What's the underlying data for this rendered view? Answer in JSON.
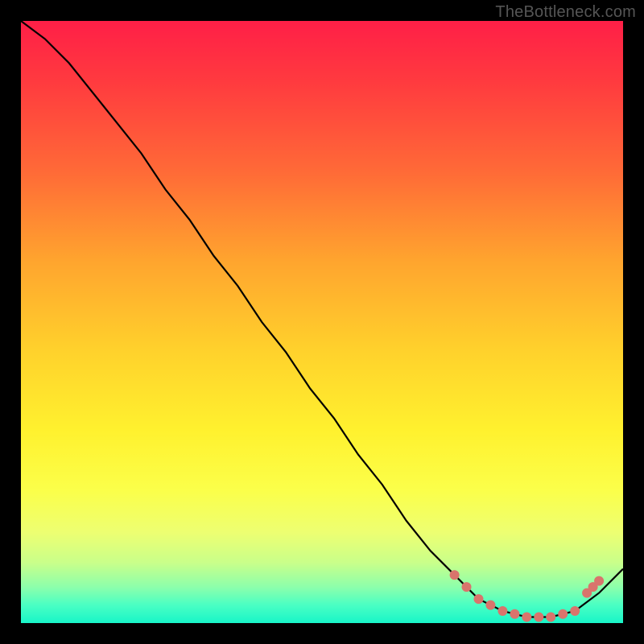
{
  "watermark": "TheBottleneck.com",
  "colors": {
    "background": "#000000",
    "gradient_top": "#ff1f47",
    "gradient_bottom": "#18f5c8",
    "curve": "#000000",
    "marker": "#d9746c"
  },
  "chart_data": {
    "type": "line",
    "title": "",
    "xlabel": "",
    "ylabel": "",
    "xlim": [
      0,
      100
    ],
    "ylim": [
      0,
      100
    ],
    "x": [
      0,
      4,
      8,
      12,
      16,
      20,
      24,
      28,
      32,
      36,
      40,
      44,
      48,
      52,
      56,
      60,
      64,
      68,
      72,
      76,
      80,
      84,
      88,
      92,
      96,
      100
    ],
    "values": [
      100,
      97,
      93,
      88,
      83,
      78,
      72,
      67,
      61,
      56,
      50,
      45,
      39,
      34,
      28,
      23,
      17,
      12,
      8,
      4,
      2,
      1,
      1,
      2,
      5,
      9
    ],
    "markers": {
      "x": [
        72,
        74,
        76,
        78,
        80,
        82,
        84,
        86,
        88,
        90,
        92,
        94,
        95,
        96
      ],
      "y": [
        8,
        6,
        4,
        3,
        2,
        1.5,
        1,
        1,
        1,
        1.5,
        2,
        5,
        6,
        7
      ]
    }
  }
}
